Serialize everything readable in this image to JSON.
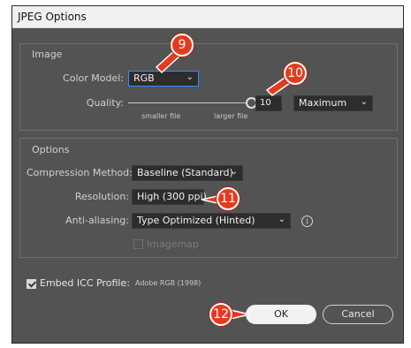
{
  "window": {
    "title": "JPEG Options"
  },
  "image": {
    "title": "Image",
    "color_model_label": "Color Model:",
    "color_model_value": "RGB",
    "quality_label": "Quality:",
    "quality_value": "10",
    "quality_preset": "Maximum",
    "smaller_file": "smaller file",
    "larger_file": "larger file"
  },
  "options": {
    "title": "Options",
    "compression_label": "Compression Method:",
    "compression_value": "Baseline (Standard)",
    "resolution_label": "Resolution:",
    "resolution_value": "High (300 ppi)",
    "antialias_label": "Anti-aliasing:",
    "antialias_value": "Type Optimized (Hinted)",
    "imagemap_label": "Imagemap",
    "imagemap_checked": false
  },
  "icc": {
    "label": "Embed ICC Profile:",
    "profile": "Adobe RGB (1998)",
    "checked": true
  },
  "buttons": {
    "ok": "OK",
    "cancel": "Cancel"
  },
  "annotations": [
    "9",
    "10",
    "11",
    "12"
  ],
  "colors": {
    "dialog_bg": "#535353",
    "callout": "#e53a1d",
    "focus_border": "#3d8bfd"
  },
  "icons": {
    "dropdown": "chevron-down-icon",
    "info": "info-icon",
    "check": "checkmark-icon"
  }
}
